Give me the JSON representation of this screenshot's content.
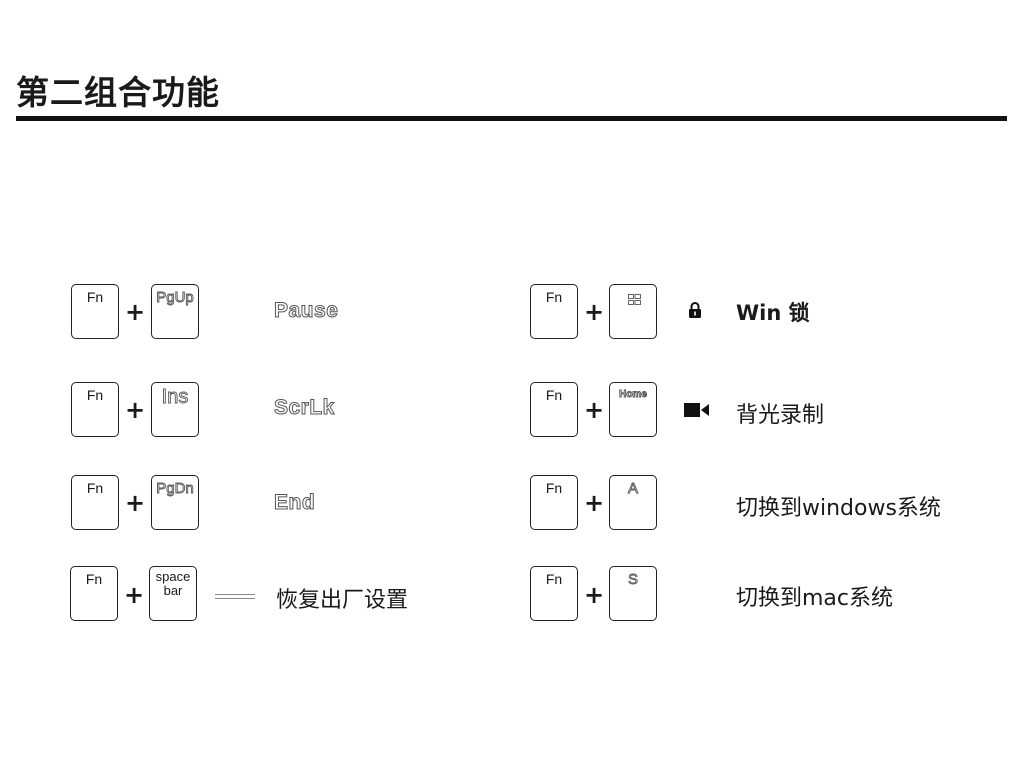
{
  "title": "第二组合功能",
  "left": [
    {
      "key1": "Fn",
      "key2": "PgUp",
      "result": "Pause"
    },
    {
      "key1": "Fn",
      "key2": "Ins",
      "result": "ScrLk"
    },
    {
      "key1": "Fn",
      "key2": "PgDn",
      "result": "End"
    },
    {
      "key1": "Fn",
      "key2_line1": "space",
      "key2_line2": "bar",
      "result": "恢复出厂设置"
    }
  ],
  "right": [
    {
      "key1": "Fn",
      "key2_icon": "windows-icon",
      "icon": "lock-icon",
      "result": "Win 锁"
    },
    {
      "key1": "Fn",
      "key2": "Home",
      "icon": "video-camera-icon",
      "result": "背光录制"
    },
    {
      "key1": "Fn",
      "key2": "A",
      "result": "切换到windows系统"
    },
    {
      "key1": "Fn",
      "key2": "S",
      "result": "切换到mac系统"
    }
  ],
  "plus": "+"
}
